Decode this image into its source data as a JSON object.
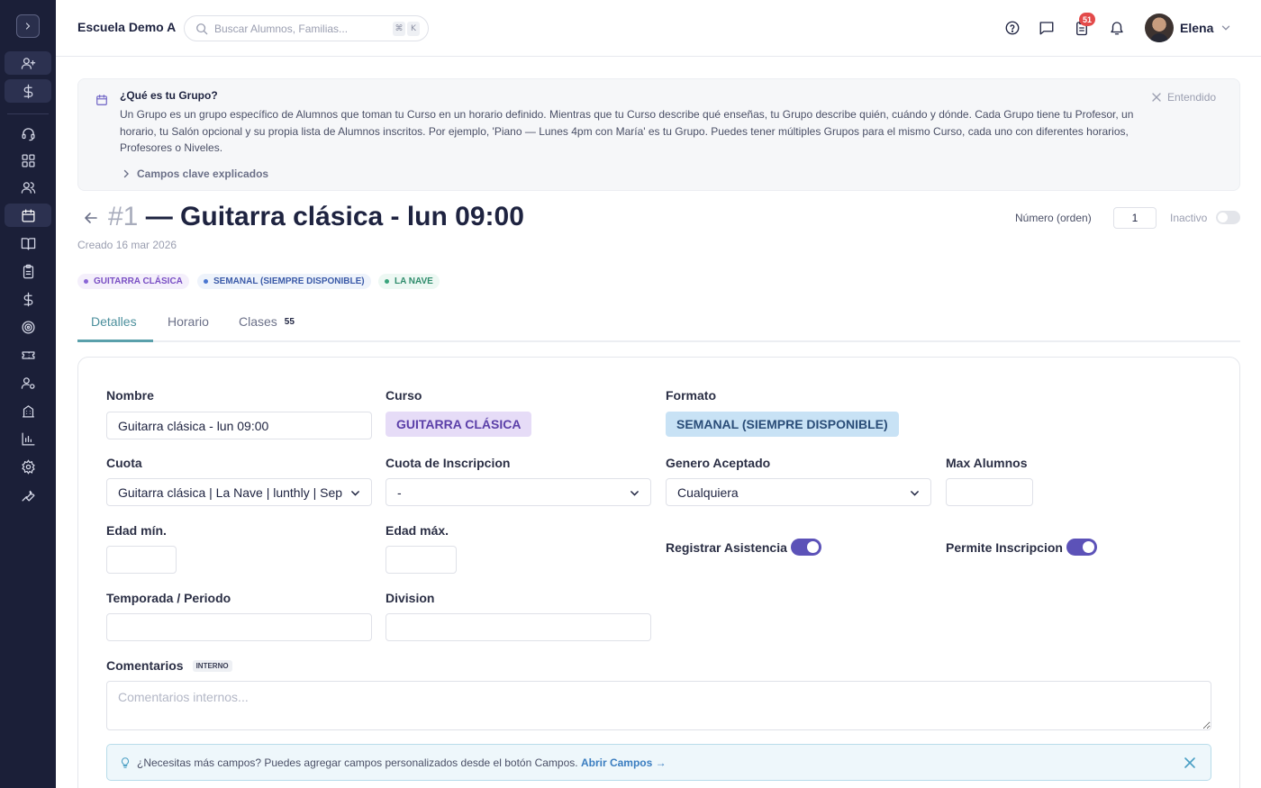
{
  "header": {
    "school_name": "Escuela Demo A",
    "search_placeholder": "Buscar Alumnos, Familias...",
    "kbd_1": "⌘",
    "kbd_2": "K",
    "notification_count": "51",
    "user_name": "Elena"
  },
  "sidebar": {
    "items": [
      "toggle",
      "add-user",
      "dollar",
      "headset",
      "dashboard",
      "users",
      "calendar",
      "book",
      "clipboard",
      "dollar",
      "target",
      "ticket",
      "user-settings",
      "building",
      "chart",
      "settings",
      "wrench"
    ]
  },
  "info": {
    "title": "¿Qué es tu Grupo?",
    "body": "Un Grupo es un grupo específico de Alumnos que toman tu Curso en un horario definido. Mientras que tu Curso describe qué enseñas, tu Grupo describe quién, cuándo y dónde. Cada Grupo tiene tu Profesor, un horario, tu Salón opcional y su propia lista de Alumnos inscritos. Por ejemplo, 'Piano — Lunes 4pm con María' es tu Grupo. Puedes tener múltiples Grupos para el mismo Curso, cada uno con diferentes horarios, Profesores o Niveles.",
    "dismiss": "Entendido",
    "key_fields": "Campos clave explicados"
  },
  "page": {
    "number": "#1",
    "title": "— Guitarra clásica - lun 09:00",
    "created": "Creado 16 mar 2026",
    "order_label": "Número (orden)",
    "order_value": "1",
    "inactive_label": "Inactivo",
    "active": false
  },
  "tags": [
    {
      "label": "GUITARRA CLÁSICA",
      "color": "#7a4fc4",
      "bg": "#f4effb"
    },
    {
      "label": "SEMANAL (SIEMPRE DISPONIBLE)",
      "color": "#3a5aa8",
      "bg": "#eef3fb"
    },
    {
      "label": "LA NAVE",
      "color": "#2f8c6c",
      "bg": "#edf8f3"
    }
  ],
  "tabs": [
    {
      "label": "Detalles",
      "active": true
    },
    {
      "label": "Horario",
      "active": false
    },
    {
      "label": "Clases",
      "count": "55",
      "active": false
    }
  ],
  "form": {
    "nombre_label": "Nombre",
    "nombre_value": "Guitarra clásica - lun 09:00",
    "curso_label": "Curso",
    "curso_value": "GUITARRA CLÁSICA",
    "formato_label": "Formato",
    "formato_value": "SEMANAL (SIEMPRE DISPONIBLE)",
    "cuota_label": "Cuota",
    "cuota_value": "Guitarra clásica | La Nave | lunthly | Sep",
    "cuota_inscripcion_label": "Cuota de Inscripcion",
    "cuota_inscripcion_value": "-",
    "genero_label": "Genero Aceptado",
    "genero_value": "Cualquiera",
    "max_alumnos_label": "Max Alumnos",
    "max_alumnos_value": "",
    "edad_min_label": "Edad mín.",
    "edad_min_value": "",
    "edad_max_label": "Edad máx.",
    "edad_max_value": "",
    "registrar_asistencia_label": "Registrar Asistencia",
    "registrar_asistencia": true,
    "permite_inscripcion_label": "Permite Inscripcion",
    "permite_inscripcion": true,
    "temporada_label": "Temporada / Periodo",
    "temporada_value": "",
    "division_label": "Division",
    "division_value": "",
    "comentarios_label": "Comentarios",
    "comentarios_badge": "INTERNO",
    "comentarios_placeholder": "Comentarios internos..."
  },
  "hint": {
    "text": "¿Necesitas más campos? Puedes agregar campos personalizados desde el botón Campos.",
    "link": "Abrir Campos →"
  },
  "colors": {
    "sidebar_bg": "#1b1f38",
    "accent_teal": "#5aa0ab",
    "toggle_purple": "#5c52b8",
    "badge_red": "#e34a4a"
  }
}
